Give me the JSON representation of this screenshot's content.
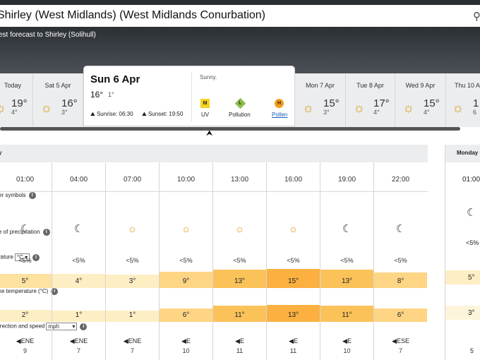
{
  "header": {
    "title": "Shirley (West Midlands) (West Midlands Conurbation)",
    "subtitle": "est forecast to Shirley (Solihull)"
  },
  "days": [
    {
      "name": "Today",
      "hi": "19°",
      "lo": "4°"
    },
    {
      "name": "Sat 5 Apr",
      "hi": "16°",
      "lo": "3°"
    },
    {
      "name": "Mon 7 Apr",
      "hi": "15°",
      "lo": "3°"
    },
    {
      "name": "Tue 8 Apr",
      "hi": "17°",
      "lo": "4°"
    },
    {
      "name": "Wed 9 Apr",
      "hi": "15°",
      "lo": "4°"
    },
    {
      "name": "Thu 10 Ap",
      "hi": "1",
      "lo": "6"
    }
  ],
  "selected_day": {
    "date": "Sun 6 Apr",
    "hi": "16°",
    "lo": "1°",
    "sunrise": "Sunrise: 06:30",
    "sunset": "Sunset: 19:50",
    "summary": "Sunny.",
    "uv": {
      "badge": "M",
      "label": "UV"
    },
    "pollution": {
      "badge": "L",
      "label": "Pollution"
    },
    "pollen": {
      "badge": "H",
      "label": "Pollen"
    }
  },
  "hourly": {
    "section": "y",
    "labels": {
      "symbols": "er symbols",
      "precip": "e of precipitation",
      "temp": "rature",
      "temp_unit": "°C",
      "feels": "ke temperature (°C)",
      "wind": "irection and speed",
      "wind_unit": "mph"
    },
    "columns": [
      {
        "time": "01:00",
        "symbol": "moon-icon",
        "precip": "<5%",
        "temp": "5°",
        "feels": "2°",
        "dir": "ENE",
        "speed": "9"
      },
      {
        "time": "04:00",
        "symbol": "moon-icon",
        "precip": "<5%",
        "temp": "4°",
        "feels": "1°",
        "dir": "ENE",
        "speed": "7"
      },
      {
        "time": "07:00",
        "symbol": "sun-icon",
        "precip": "<5%",
        "temp": "3°",
        "feels": "1°",
        "dir": "ENE",
        "speed": "7"
      },
      {
        "time": "10:00",
        "symbol": "sun-icon",
        "precip": "<5%",
        "temp": "9°",
        "feels": "6°",
        "dir": "E",
        "speed": "10"
      },
      {
        "time": "13:00",
        "symbol": "sun-icon",
        "precip": "<5%",
        "temp": "13°",
        "feels": "11°",
        "dir": "E",
        "speed": "11"
      },
      {
        "time": "16:00",
        "symbol": "sun-icon",
        "precip": "<5%",
        "temp": "15°",
        "feels": "13°",
        "dir": "E",
        "speed": "11"
      },
      {
        "time": "19:00",
        "symbol": "moon-icon",
        "precip": "<5%",
        "temp": "13°",
        "feels": "11°",
        "dir": "E",
        "speed": "10"
      },
      {
        "time": "22:00",
        "symbol": "moon-icon",
        "precip": "<5%",
        "temp": "8°",
        "feels": "6°",
        "dir": "ESE",
        "speed": "7"
      }
    ]
  },
  "next_day": {
    "name": "Monday",
    "time": "01:00",
    "symbol": "moon-icon",
    "precip": "<5%",
    "temp": "5°",
    "feels": "3°",
    "speed": "5"
  },
  "colors": {
    "temp_heat": [
      "#fdeec4",
      "#fde2a0",
      "#fdd584",
      "#fcc25a",
      "#fbb040"
    ]
  }
}
